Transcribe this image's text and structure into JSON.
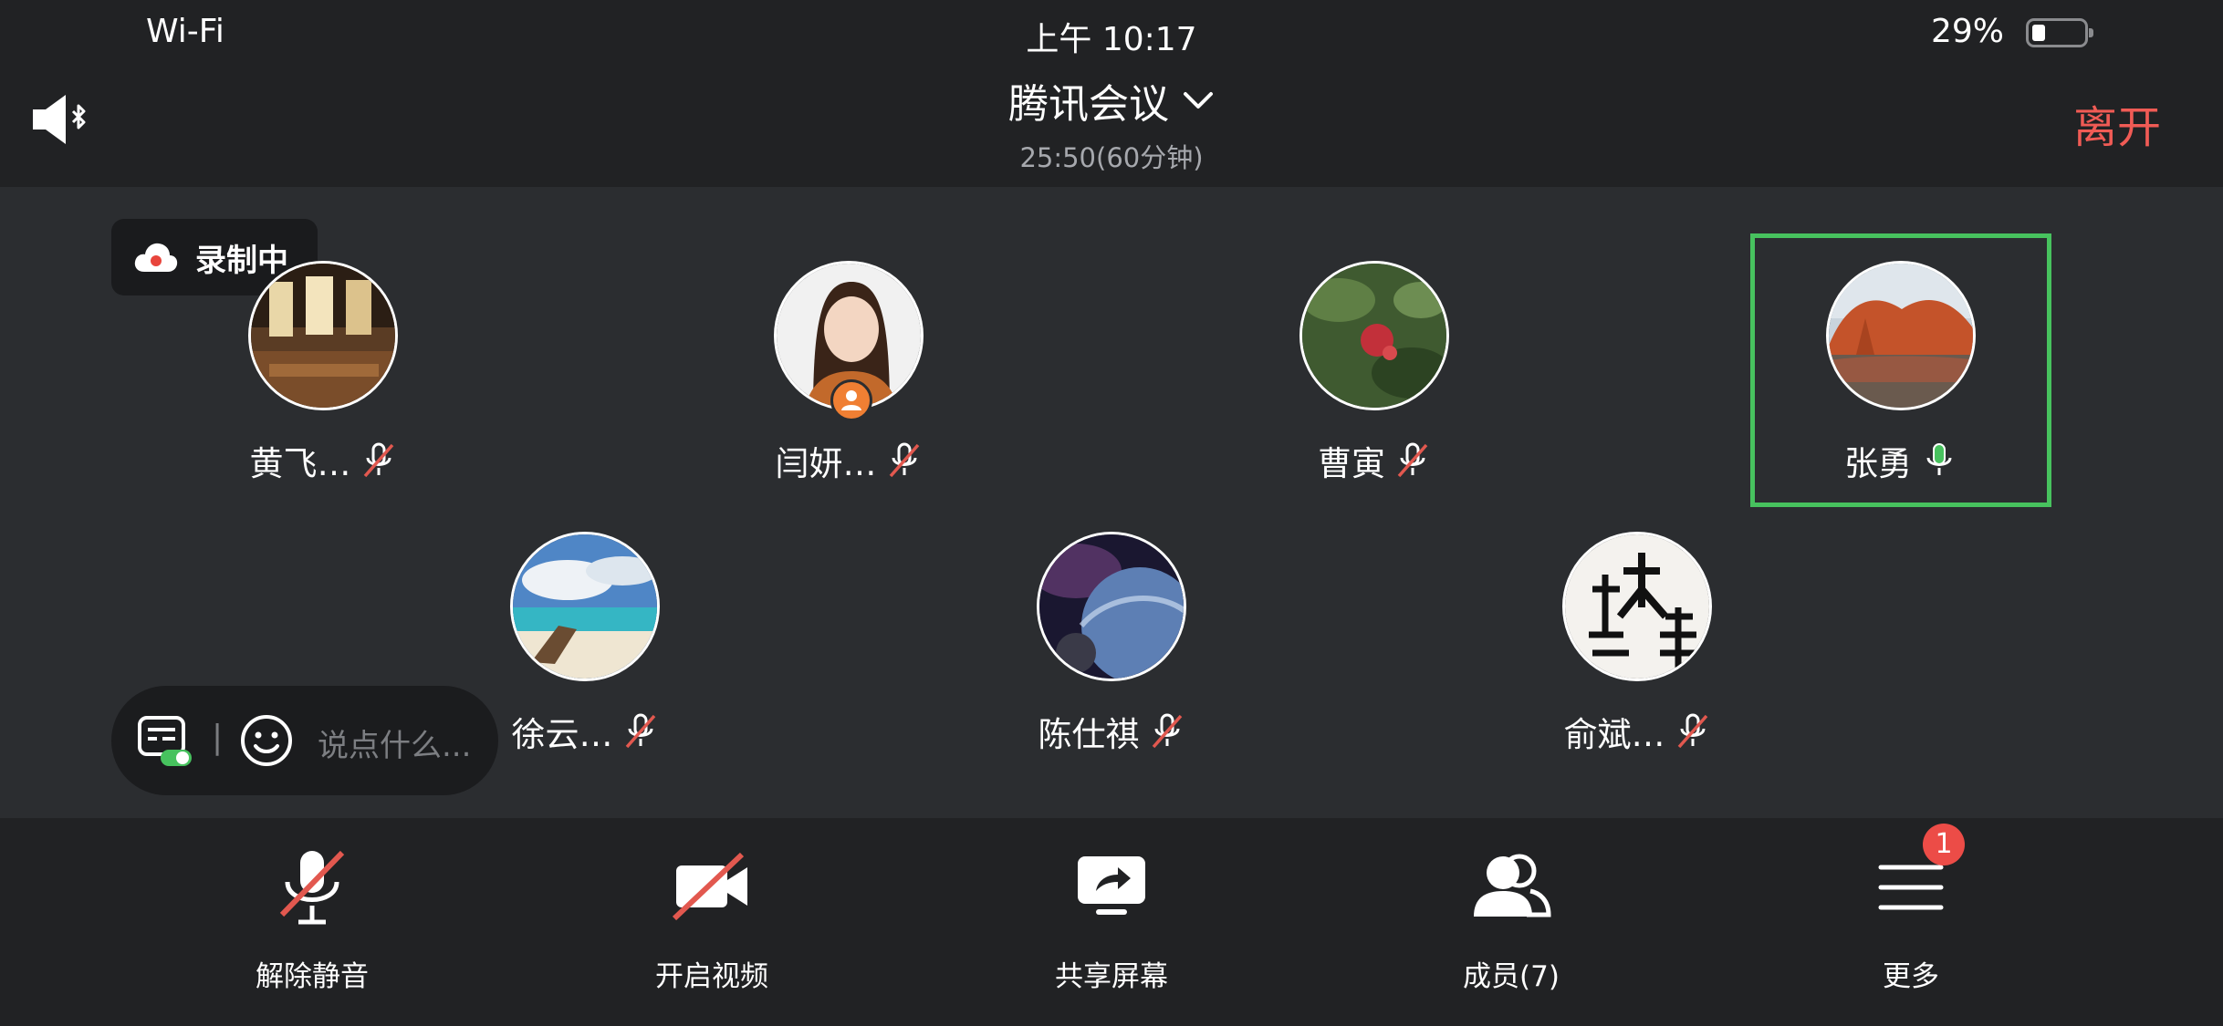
{
  "status_bar": {
    "wifi": "Wi-Fi",
    "time": "上午 10:17",
    "battery_pct": "29%",
    "battery_level": 0.29
  },
  "header": {
    "title": "腾讯会议",
    "subtitle": "25:50(60分钟)",
    "leave": "离开"
  },
  "recording": {
    "label": "录制中"
  },
  "participants": [
    {
      "name": "黄飞…",
      "muted": true
    },
    {
      "name": "闫妍…",
      "muted": true,
      "host": true
    },
    {
      "name": "曹寅",
      "muted": true
    },
    {
      "name": "张勇",
      "muted": false,
      "speaking": true
    },
    {
      "name": "徐云…",
      "muted": true
    },
    {
      "name": "陈仕祺",
      "muted": true
    },
    {
      "name": "俞斌…",
      "muted": true
    }
  ],
  "chat": {
    "divider": "|",
    "placeholder": "说点什么..."
  },
  "toolbar": {
    "unmute": "解除静音",
    "video": "开启视频",
    "share": "共享屏幕",
    "members": "成员(7)",
    "more": "更多",
    "more_badge": "1"
  },
  "colors": {
    "leave": "#f05b55",
    "active_border": "#47c25e",
    "mute_slash": "#e2584f",
    "badge": "#ec4c47",
    "host_badge": "#f07f33"
  }
}
